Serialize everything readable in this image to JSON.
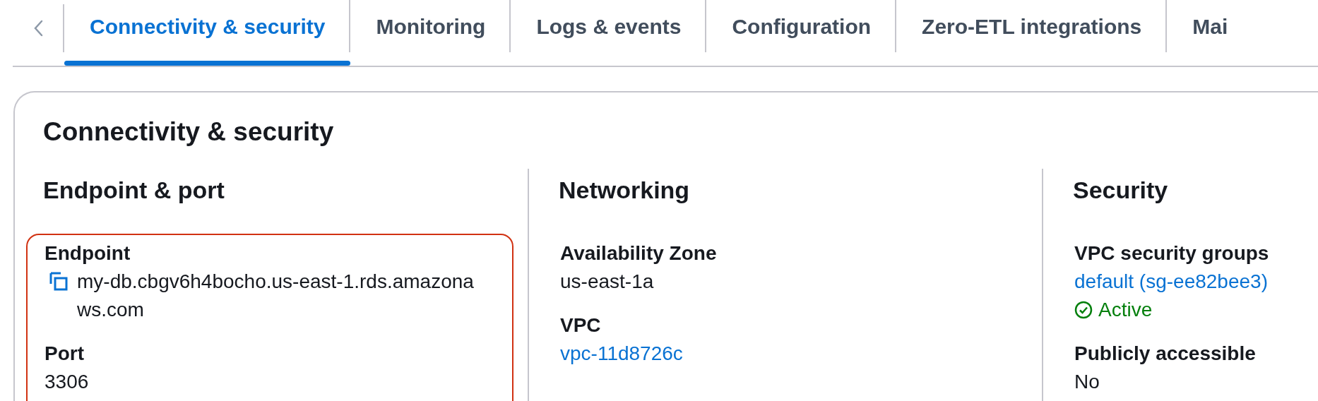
{
  "tabs": [
    {
      "label": "Connectivity & security",
      "selected": true
    },
    {
      "label": "Monitoring",
      "selected": false
    },
    {
      "label": "Logs & events",
      "selected": false
    },
    {
      "label": "Configuration",
      "selected": false
    },
    {
      "label": "Zero-ETL integrations",
      "selected": false
    },
    {
      "label": "Mai",
      "selected": false
    }
  ],
  "panel": {
    "title": "Connectivity & security",
    "columns": [
      {
        "heading": "Endpoint & port",
        "highlighted": true,
        "fields": [
          {
            "label": "Endpoint",
            "kind": "copyable",
            "value": "my-db.cbgv6h4bocho.us-east-1.rds.amazonaws.com"
          },
          {
            "label": "Port",
            "kind": "text",
            "value": "3306"
          }
        ]
      },
      {
        "heading": "Networking",
        "highlighted": false,
        "fields": [
          {
            "label": "Availability Zone",
            "kind": "text",
            "value": "us-east-1a"
          },
          {
            "label": "VPC",
            "kind": "link",
            "value": "vpc-11d8726c"
          }
        ]
      },
      {
        "heading": "Security",
        "highlighted": false,
        "fields": [
          {
            "label": "VPC security groups",
            "kind": "link",
            "value": "default (sg-ee82bee3)",
            "status": "Active"
          },
          {
            "label": "Publicly accessible",
            "kind": "text",
            "value": "No"
          }
        ]
      }
    ]
  }
}
